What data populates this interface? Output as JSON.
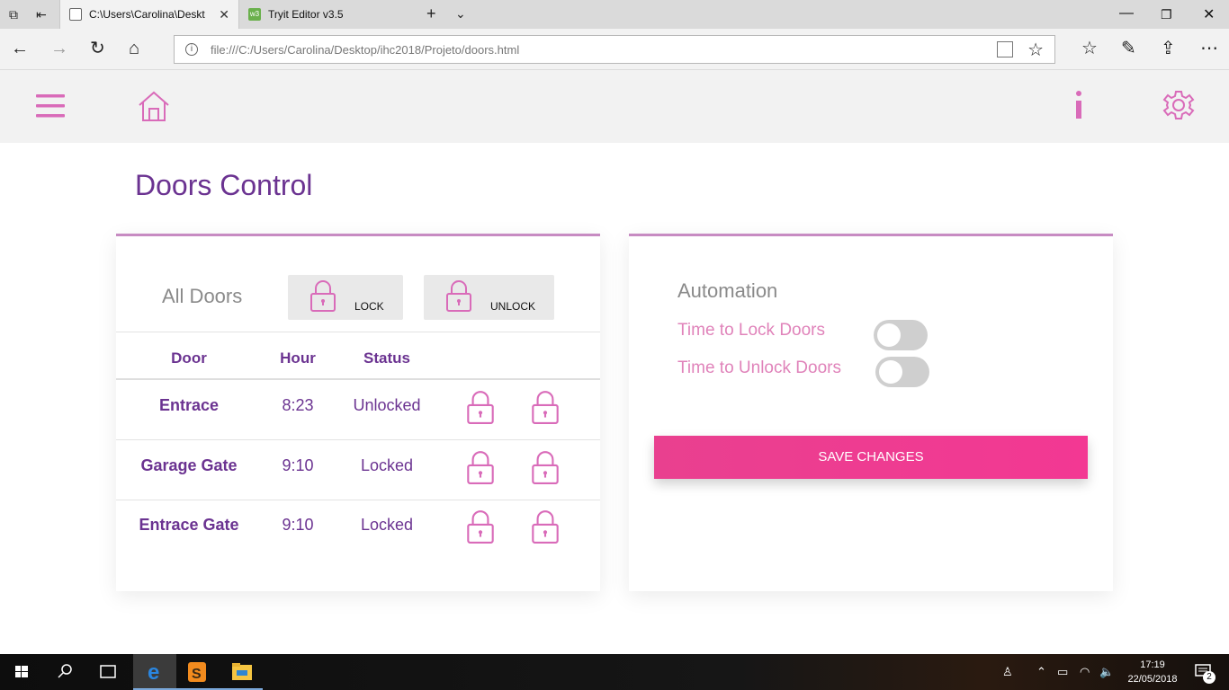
{
  "browser": {
    "tabs": [
      {
        "title": "C:\\Users\\Carolina\\Deskt",
        "active": true
      },
      {
        "title": "Tryit Editor v3.5",
        "active": false
      }
    ],
    "address": "file:///C:/Users/Carolina/Desktop/ihc2018/Projeto/doors.html"
  },
  "page": {
    "title": "Doors Control"
  },
  "doors_panel": {
    "all_doors_label": "All Doors",
    "lock_button": "LOCK",
    "unlock_button": "UNLOCK",
    "columns": [
      "Door",
      "Hour",
      "Status"
    ],
    "rows": [
      {
        "door": "Entrace",
        "hour": "8:23",
        "status": "Unlocked"
      },
      {
        "door": "Garage Gate",
        "hour": "9:10",
        "status": "Locked"
      },
      {
        "door": "Entrace Gate",
        "hour": "9:10",
        "status": "Locked"
      }
    ]
  },
  "automation": {
    "title": "Automation",
    "lock_label": "Time to Lock Doors",
    "unlock_label": "Time to Unlock Doors",
    "lock_enabled": false,
    "unlock_enabled": false,
    "save_button": "SAVE CHANGES"
  },
  "colors": {
    "accent_purple": "#6b3391",
    "accent_pink": "#e083ba",
    "button_pink": "#f03a91",
    "icon_pink": "#d96bb9"
  },
  "taskbar": {
    "time": "17:19",
    "date": "22/05/2018",
    "notifications": "2"
  }
}
